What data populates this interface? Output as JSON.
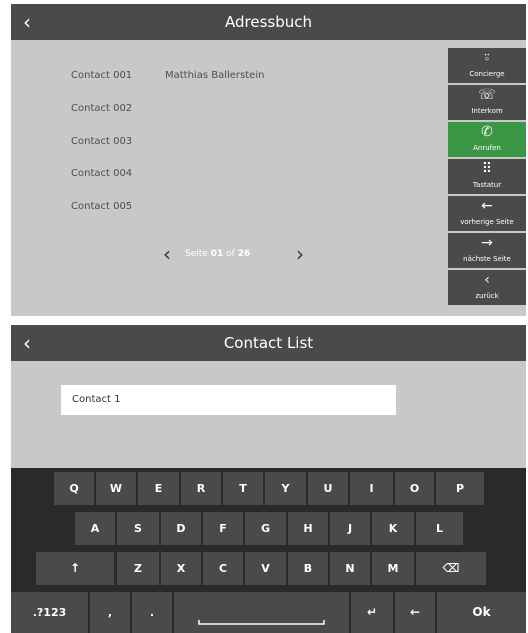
{
  "screen1": {
    "back_glyph": "‹",
    "title": "Adressbuch",
    "contacts": [
      {
        "id": "Contact 001",
        "name": "Matthias Ballerstein"
      },
      {
        "id": "Contact 002",
        "name": ""
      },
      {
        "id": "Contact 003",
        "name": ""
      },
      {
        "id": "Contact 004",
        "name": ""
      },
      {
        "id": "Contact 005",
        "name": ""
      }
    ],
    "pager": {
      "prev_glyph": "‹",
      "next_glyph": "›",
      "label": "Seite",
      "current": "01",
      "of": "of",
      "total": "26"
    },
    "sidebar": [
      {
        "icon": "concierge-bell-icon",
        "glyph": "⍤",
        "label": "Concierge",
        "active": false
      },
      {
        "icon": "intercom-phone-icon",
        "glyph": "☏",
        "label": "Interkom",
        "active": false
      },
      {
        "icon": "handset-icon",
        "glyph": "✆",
        "label": "Anrufen",
        "active": true
      },
      {
        "icon": "keypad-icon",
        "glyph": "⠿",
        "label": "Tastatur",
        "active": false
      },
      {
        "icon": "arrow-left-icon",
        "glyph": "←",
        "label": "vorherige Seite",
        "active": false
      },
      {
        "icon": "arrow-right-icon",
        "glyph": "→",
        "label": "nächste Seite",
        "active": false
      },
      {
        "icon": "chevron-left-icon",
        "glyph": "‹",
        "label": "zurück",
        "active": false
      }
    ],
    "colors": {
      "active": "#3b9645",
      "panel": "#4a4a4a",
      "background": "#c8c8c8"
    }
  },
  "screen2": {
    "back_glyph": "‹",
    "title": "Contact List",
    "input_value": "Contact 1",
    "keyboard": {
      "row1": [
        "Q",
        "W",
        "E",
        "R",
        "T",
        "Y",
        "U",
        "I",
        "O",
        "P"
      ],
      "row2": [
        "A",
        "S",
        "D",
        "F",
        "G",
        "H",
        "J",
        "K",
        "L"
      ],
      "row3": [
        "↑",
        "Z",
        "X",
        "C",
        "V",
        "B",
        "N",
        "M",
        "⌫"
      ],
      "row4": [
        ".?123",
        ",",
        ".",
        "space",
        "↵",
        "←",
        "Ok"
      ]
    }
  }
}
